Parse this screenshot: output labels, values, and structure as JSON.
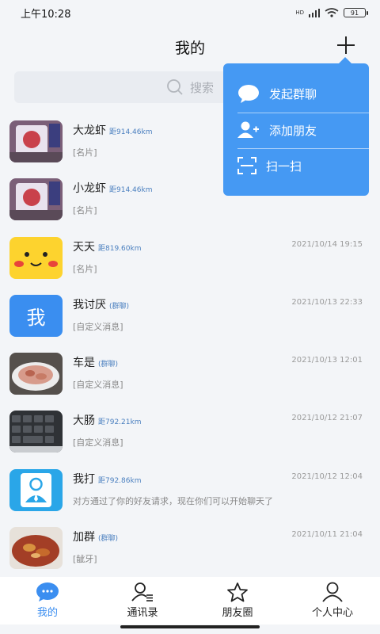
{
  "status_bar": {
    "time": "上午10:28",
    "signal_label": "HD",
    "battery": "91"
  },
  "header": {
    "title": "我的"
  },
  "search": {
    "placeholder": "搜索"
  },
  "popup_menu": {
    "items": [
      {
        "label": "发起群聊",
        "icon": "chat-bubble-icon"
      },
      {
        "label": "添加朋友",
        "icon": "add-person-icon"
      },
      {
        "label": "扫一扫",
        "icon": "scan-icon"
      }
    ]
  },
  "chats": [
    {
      "name": "大龙虾",
      "tag": "距914.46km",
      "time": "",
      "message": "[名片]",
      "avatar": "red-figure-photo"
    },
    {
      "name": "小龙虾",
      "tag": "距914.46km",
      "time": "",
      "message": "[名片]",
      "avatar": "red-figure-photo"
    },
    {
      "name": "天天",
      "tag": "距819.60km",
      "time": "2021/10/14 19:15",
      "message": "[名片]",
      "avatar": "yellow-character"
    },
    {
      "name": "我讨厌",
      "tag": "(群聊)",
      "time": "2021/10/13 22:33",
      "message": "[自定义消息]",
      "avatar": "text-avatar",
      "avatar_text": "我"
    },
    {
      "name": "车是",
      "tag": "(群聊)",
      "time": "2021/10/13 12:01",
      "message": "[自定义消息]",
      "avatar": "food-plate-photo"
    },
    {
      "name": "大肠",
      "tag": "距792.21km",
      "time": "2021/10/12 21:07",
      "message": "[自定义消息]",
      "avatar": "keyboard-photo"
    },
    {
      "name": "我打",
      "tag": "距792.86km",
      "time": "2021/10/12 12:04",
      "message": "对方通过了你的好友请求，现在你们可以开始聊天了",
      "avatar": "default-person"
    },
    {
      "name": "加群",
      "tag": "(群聊)",
      "time": "2021/10/11 21:04",
      "message": "[龇牙]",
      "avatar": "food-bowl-photo"
    }
  ],
  "bottom_nav": [
    {
      "label": "我的",
      "icon": "chat-icon",
      "active": true
    },
    {
      "label": "通讯录",
      "icon": "contacts-icon",
      "active": false
    },
    {
      "label": "朋友圈",
      "icon": "star-icon",
      "active": false
    },
    {
      "label": "个人中心",
      "icon": "person-icon",
      "active": false
    }
  ],
  "colors": {
    "accent": "#3b8ef0",
    "popup": "#4599f3",
    "tag": "#4a7fbf"
  }
}
